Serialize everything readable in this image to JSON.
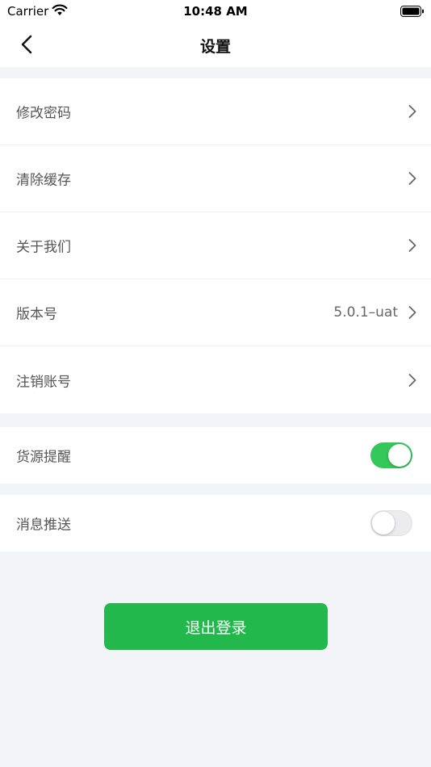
{
  "status_bar": {
    "carrier": "Carrier",
    "time": "10:48 AM"
  },
  "nav": {
    "title": "设置",
    "back_icon": "chevron-left-icon"
  },
  "settings_group": {
    "items": [
      {
        "label": "修改密码",
        "value": ""
      },
      {
        "label": "清除缓存",
        "value": ""
      },
      {
        "label": "关于我们",
        "value": ""
      },
      {
        "label": "版本号",
        "value": "5.0.1–uat"
      },
      {
        "label": "注销账号",
        "value": ""
      }
    ]
  },
  "toggles": {
    "supply_reminder": {
      "label": "货源提醒",
      "on": true
    },
    "message_push": {
      "label": "消息推送",
      "on": false
    }
  },
  "logout": {
    "label": "退出登录"
  },
  "colors": {
    "accent_green": "#22b84c",
    "toggle_on": "#34c759",
    "background": "#f3f4f7"
  }
}
